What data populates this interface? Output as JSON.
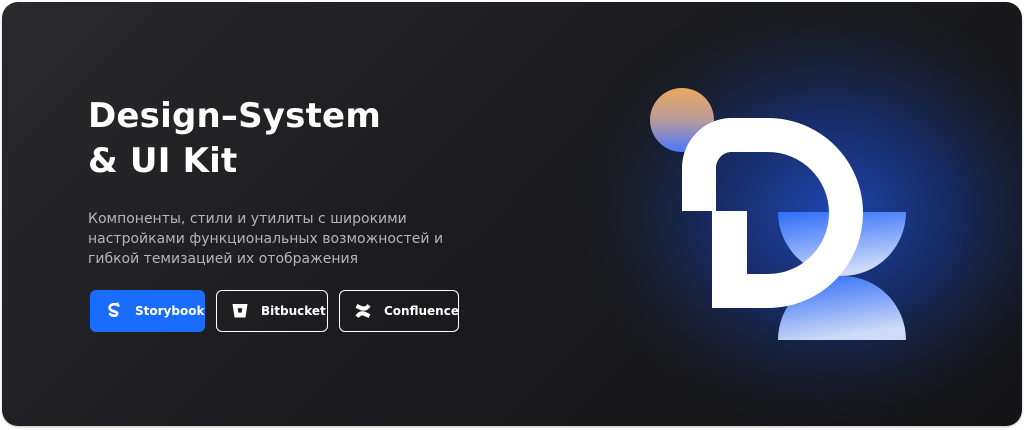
{
  "hero": {
    "title_line1": "Design–System",
    "title_line2": "& UI Kit",
    "subtitle": "Компоненты, стили и утилиты с широкими настройками функциональных возможностей и гибкой темизацией их отображения"
  },
  "buttons": {
    "storybook": {
      "label": "Storybook",
      "icon": "storybook-icon"
    },
    "bitbucket": {
      "label": "Bitbucket",
      "icon": "bitbucket-icon"
    },
    "confluence": {
      "label": "Confluence",
      "icon": "confluence-icon"
    }
  },
  "colors": {
    "card_background": "#1c1c1f",
    "primary": "#1a6cff",
    "text": "#ffffff",
    "muted_text": "#b4b4b9",
    "sphere_top": "#e8a861",
    "sphere_bottom": "#4a7cff"
  },
  "illustration": {
    "icon": "design-system-logo-icon"
  }
}
